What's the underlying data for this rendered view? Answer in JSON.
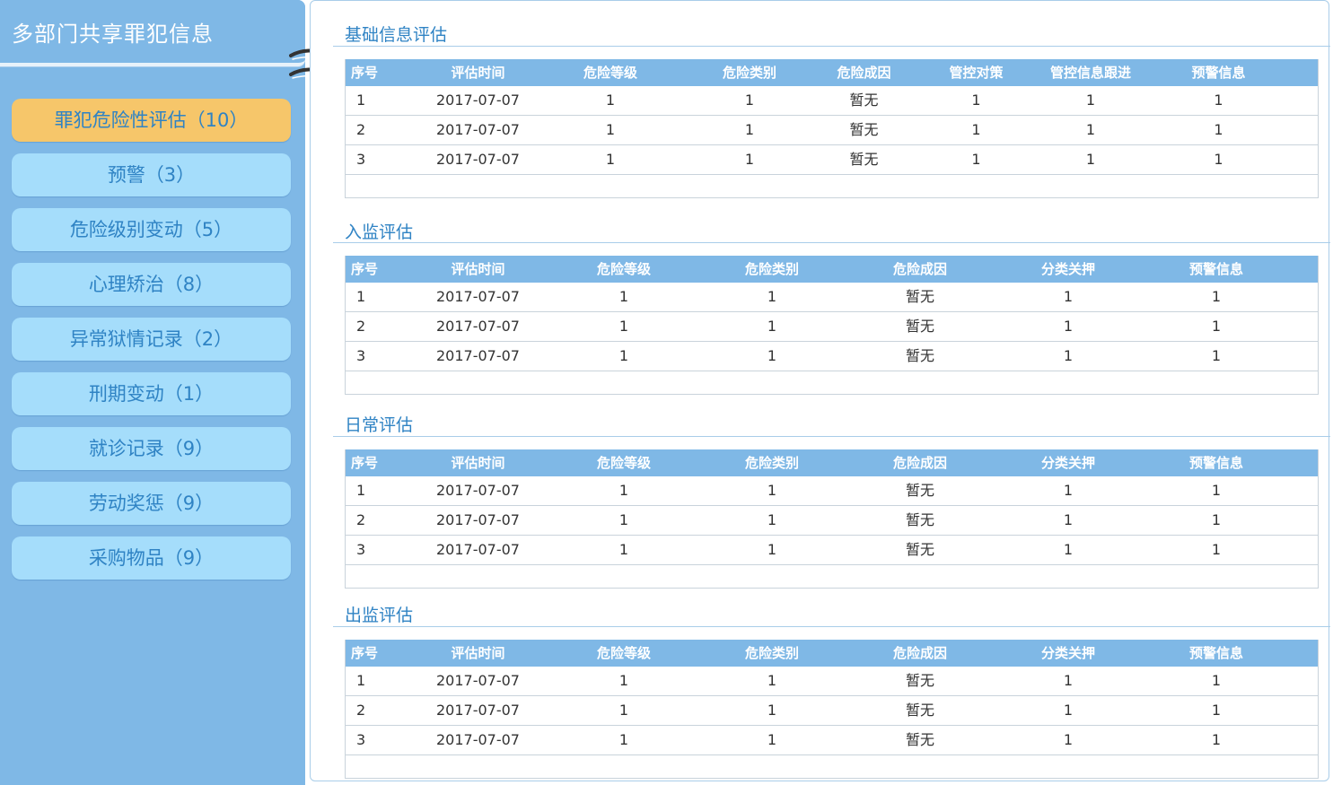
{
  "sidebar": {
    "title": "多部门共享罪犯信息",
    "items": [
      {
        "label": "罪犯危险性评估（10）",
        "active": true
      },
      {
        "label": "预警（3）"
      },
      {
        "label": "危险级别变动（5）"
      },
      {
        "label": "心理矫治（8）"
      },
      {
        "label": "异常狱情记录（2）"
      },
      {
        "label": "刑期变动（1）"
      },
      {
        "label": "就诊记录（9）"
      },
      {
        "label": "劳动奖惩（9）"
      },
      {
        "label": "采购物品（9）"
      }
    ]
  },
  "sections": [
    {
      "title": "基础信息评估",
      "headers": [
        "序号",
        "评估时间",
        "危险等级",
        "危险类别",
        "危险成因",
        "管控对策",
        "管控信息跟进",
        "预警信息"
      ],
      "rows": [
        [
          "1",
          "2017-07-07",
          "1",
          "1",
          "暂无",
          "1",
          "1",
          "1"
        ],
        [
          "2",
          "2017-07-07",
          "1",
          "1",
          "暂无",
          "1",
          "1",
          "1"
        ],
        [
          "3",
          "2017-07-07",
          "1",
          "1",
          "暂无",
          "1",
          "1",
          "1"
        ]
      ]
    },
    {
      "title": "入监评估",
      "headers": [
        "序号",
        "评估时间",
        "危险等级",
        "危险类别",
        "危险成因",
        "分类关押",
        "预警信息"
      ],
      "rows": [
        [
          "1",
          "2017-07-07",
          "1",
          "1",
          "暂无",
          "1",
          "1"
        ],
        [
          "2",
          "2017-07-07",
          "1",
          "1",
          "暂无",
          "1",
          "1"
        ],
        [
          "3",
          "2017-07-07",
          "1",
          "1",
          "暂无",
          "1",
          "1"
        ]
      ]
    },
    {
      "title": "日常评估",
      "headers": [
        "序号",
        "评估时间",
        "危险等级",
        "危险类别",
        "危险成因",
        "分类关押",
        "预警信息"
      ],
      "rows": [
        [
          "1",
          "2017-07-07",
          "1",
          "1",
          "暂无",
          "1",
          "1"
        ],
        [
          "2",
          "2017-07-07",
          "1",
          "1",
          "暂无",
          "1",
          "1"
        ],
        [
          "3",
          "2017-07-07",
          "1",
          "1",
          "暂无",
          "1",
          "1"
        ]
      ]
    },
    {
      "title": "出监评估",
      "headers": [
        "序号",
        "评估时间",
        "危险等级",
        "危险类别",
        "危险成因",
        "分类关押",
        "预警信息"
      ],
      "rows": [
        [
          "1",
          "2017-07-07",
          "1",
          "1",
          "暂无",
          "1",
          "1"
        ],
        [
          "2",
          "2017-07-07",
          "1",
          "1",
          "暂无",
          "1",
          "1"
        ],
        [
          "3",
          "2017-07-07",
          "1",
          "1",
          "暂无",
          "1",
          "1"
        ]
      ]
    }
  ],
  "colors": {
    "sidebar_bg": "#7fb8e6",
    "nav_item_bg": "#a5ddfb",
    "nav_item_active_bg": "#f6c66a",
    "accent_text": "#2f83c4",
    "table_header_bg": "#7fb8e6"
  }
}
